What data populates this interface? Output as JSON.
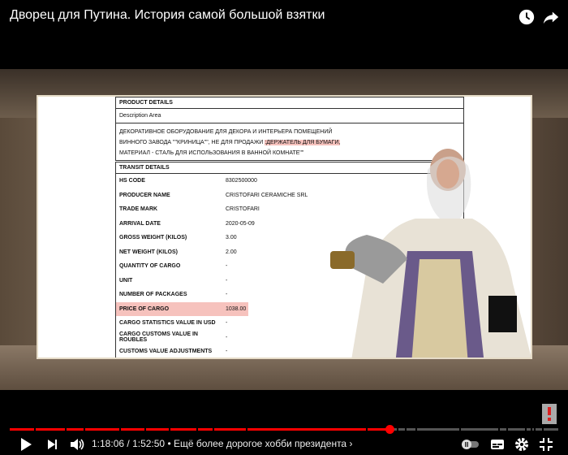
{
  "video": {
    "title": "Дворец для Путина. История самой большой взятки",
    "current_time": "1:18:06",
    "duration": "1:52:50",
    "chapter": "Ещё более дорогое хобби президента",
    "progress_fraction": 0.692,
    "accent": "#ff0000"
  },
  "icons": [
    "clock-icon",
    "share-icon",
    "play-icon",
    "next-icon",
    "volume-icon",
    "autoplay-toggle-icon",
    "subtitles-icon",
    "gear-icon",
    "exit-fullscreen-icon",
    "channel-logo-icon"
  ],
  "product": {
    "header": "PRODUCT DETAILS",
    "area": "Description Area",
    "line1": "ДЕКОРАТИВНОЕ ОБОРУДОВАНИЕ ДЛЯ ДЕКОРА И ИНТЕРЬЕРА ПОМЕЩЕНИЙ",
    "line2a": "ВИННОГО ЗАВОДА \"\"КРИНИЦА\"\", НЕ ДЛЯ ПРОДАЖИ ",
    "line2b": ":ДЕРЖАТЕЛЬ ДЛЯ БУМАГИ,",
    "line3": "МАТЕРИАЛ - СТАЛЬ ДЛЯ ИСПОЛЬЗОВАНИЯ В ВАННОЙ КОМНАТЕ\"\""
  },
  "transit": {
    "header": "TRANSIT DETAILS",
    "rows": [
      {
        "k": "HS CODE",
        "v": "8302500000"
      },
      {
        "k": "PRODUCER NAME",
        "v": "CRISTOFARI CERAMICHE SRL"
      },
      {
        "k": "TRADE MARK",
        "v": "CRISTOFARI"
      },
      {
        "k": "ARRIVAL DATE",
        "v": "2020-05-09"
      },
      {
        "k": "GROSS WEIGHT (KILOS)",
        "v": "3.00"
      },
      {
        "k": "NET WEIGHT (KILOS)",
        "v": "2.00"
      },
      {
        "k": "QUANTITY OF CARGO",
        "v": "-"
      },
      {
        "k": "UNIT",
        "v": "-"
      },
      {
        "k": "NUMBER OF PACKAGES",
        "v": "-"
      },
      {
        "k": "PRICE OF CARGO",
        "v": "1038.00"
      },
      {
        "k": "CARGO STATISTICS VALUE IN USD",
        "v": "-"
      },
      {
        "k": "CARGO CUSTOMS VALUE IN ROUBLES",
        "v": "-"
      },
      {
        "k": "CUSTOMS VALUE ADJUSTMENTS",
        "v": "-"
      }
    ]
  }
}
